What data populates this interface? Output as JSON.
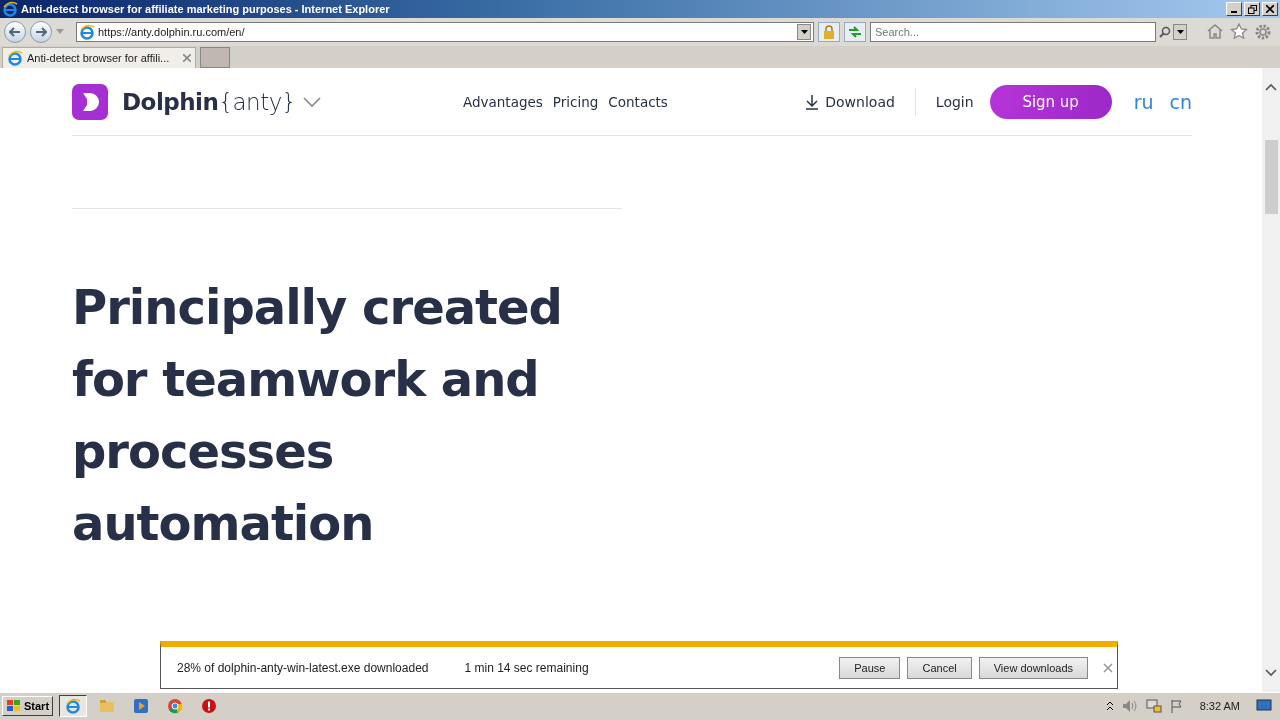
{
  "window": {
    "title": "Anti-detect browser for affiliate marketing purposes - Internet Explorer"
  },
  "address_bar": {
    "url": "https://anty.dolphin.ru.com/en/"
  },
  "search": {
    "placeholder": "Search..."
  },
  "tabs": [
    {
      "label": "Anti-detect browser for affili...",
      "selected": true
    }
  ],
  "site": {
    "logo": {
      "brand": "Dolphin",
      "suffix": "{anty}"
    },
    "nav": [
      "Advantages",
      "Pricing",
      "Contacts"
    ],
    "download": "Download",
    "login": "Login",
    "signup": "Sign up",
    "languages": [
      "ru",
      "cn"
    ],
    "heading": "Principally created for teamwork and processes automation"
  },
  "download_bar": {
    "status": "28% of dolphin-anty-win-latest.exe downloaded",
    "remaining": "1 min 14 sec remaining",
    "buttons": [
      "Pause",
      "Cancel",
      "View downloads"
    ]
  },
  "taskbar": {
    "start": "Start",
    "clock": "8:32 AM"
  }
}
